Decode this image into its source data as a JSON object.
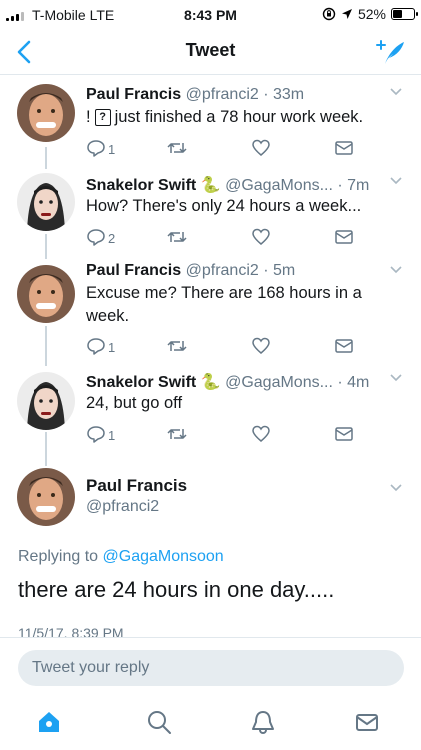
{
  "status_bar": {
    "carrier": "T-Mobile  LTE",
    "time": "8:43 PM",
    "battery_percent": "52%",
    "battery_level": 0.52
  },
  "nav": {
    "title": "Tweet"
  },
  "tweets": [
    {
      "name": "Paul Francis",
      "handle": "@pfranci2",
      "time": "33m",
      "text_before": "!",
      "unknown_glyph": "?",
      "text_after": "just finished a 78 hour work week.",
      "replies": "1"
    },
    {
      "name": "Snakelor Swift",
      "emoji": "🐍",
      "handle": "@GagaMons...",
      "time": "7m",
      "text": "How? There's only 24 hours a week...",
      "replies": "2"
    },
    {
      "name": "Paul Francis",
      "handle": "@pfranci2",
      "time": "5m",
      "text": "Excuse me? There are 168 hours in a week.",
      "replies": "1"
    },
    {
      "name": "Snakelor Swift",
      "emoji": "🐍",
      "handle": "@GagaMons...",
      "time": "4m",
      "text": "24, but go off",
      "replies": "1"
    }
  ],
  "main_tweet": {
    "name": "Paul Francis",
    "handle": "@pfranci2",
    "replying_prefix": "Replying to",
    "replying_to": "@GagaMonsoon",
    "text": "there are 24 hours in one day.....",
    "date": "11/5/17, 8:39 PM"
  },
  "reply": {
    "placeholder": "Tweet your reply"
  },
  "colors": {
    "accent": "#1da1f2",
    "muted": "#657786",
    "text": "#14171a",
    "divider": "#e1e8ed"
  },
  "icons": [
    "back-icon",
    "compose-icon",
    "reply-icon",
    "retweet-icon",
    "like-icon",
    "message-icon",
    "home-icon",
    "search-icon",
    "notifications-icon",
    "messages-icon"
  ]
}
